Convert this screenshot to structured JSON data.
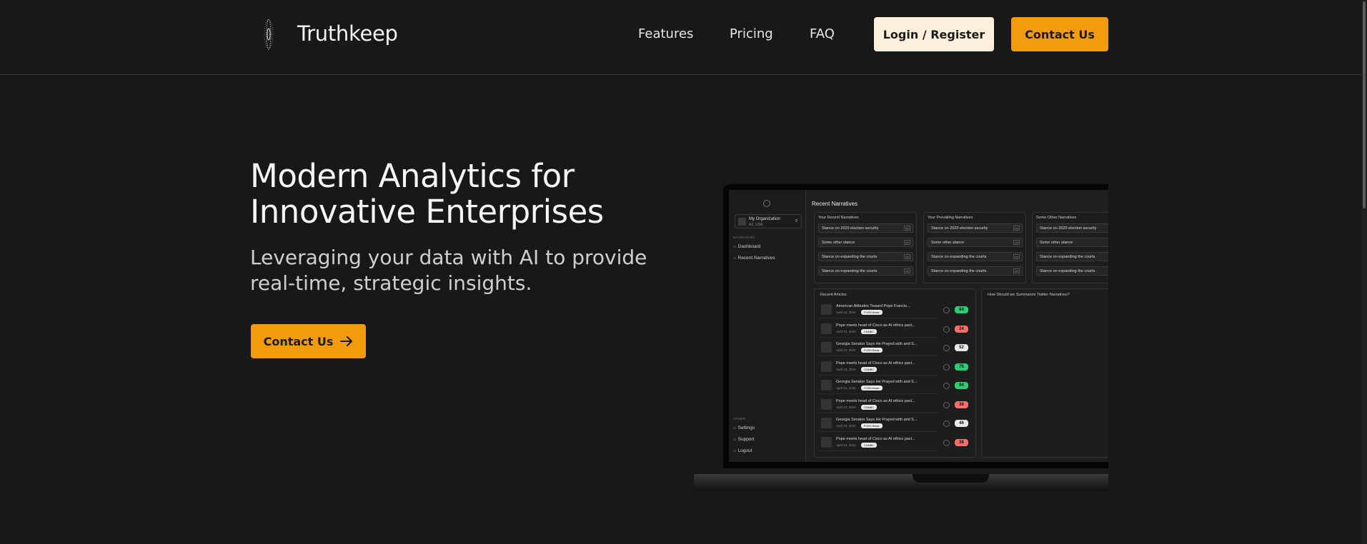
{
  "header": {
    "brand": "Truthkeep",
    "nav": [
      "Features",
      "Pricing",
      "FAQ"
    ],
    "login_label": "Login / Register",
    "contact_label": "Contact Us"
  },
  "hero": {
    "title_line1": "Modern Analytics for",
    "title_line2": "Innovative Enterprises",
    "subtitle_line1": "Leveraging your data with AI to provide",
    "subtitle_line2": "real-time, strategic insights.",
    "cta_label": "Contact Us",
    "cta_icon": "arrow-right-icon"
  },
  "colors": {
    "background": "#181818",
    "accent": "#f39c0b",
    "login_bg": "#fdf0dc"
  },
  "dashboard": {
    "org_name": "My Organization",
    "org_location": "AZ, USA",
    "nav_section": "NAVIGATION",
    "nav_items": [
      "Dashboard",
      "Recent Narratives"
    ],
    "other_section": "OTHER",
    "other_items": [
      "Settings",
      "Support",
      "Logout"
    ],
    "main_title": "Recent Narratives",
    "narrative_cards": [
      {
        "title": "Your Recent Narratives",
        "items": [
          "Stance on 2020 election security",
          "Some other stance",
          "Stance on expanding the courts",
          "Stance on expanding the courts"
        ]
      },
      {
        "title": "Your Prevailing Narratives",
        "items": [
          "Stance on 2020 election security",
          "Some other stance",
          "Stance on expanding the courts",
          "Stance on expanding the courts"
        ]
      },
      {
        "title": "Some Other Narratives",
        "items": [
          "Stance on 2020 election security",
          "Some other stance",
          "Stance on expanding the courts",
          "Stance on expanding the courts"
        ]
      }
    ],
    "articles_title": "Recent Articles",
    "summary_title": "How Should we Summarize Twitter Narratives?",
    "articles": [
      {
        "title": "American Attitudes Toward Pope Francis...",
        "date": "April 24, 2024",
        "tag": "FOX9 News",
        "score": "84",
        "score_color": "#2ecc71"
      },
      {
        "title": "Pope meets head of Cisco as AI ethics pact...",
        "date": "April 24, 2024",
        "tag": "CNNBC",
        "score": "24",
        "score_color": "#f1706a"
      },
      {
        "title": "Georgia Senator Says He Prayed with and S...",
        "date": "April 24, 2024",
        "tag": "FOX9 News",
        "score": "52",
        "score_color": "#e9e9e9"
      },
      {
        "title": "Pope meets head of Cisco as AI ethics pact...",
        "date": "April 24, 2024",
        "tag": "CNNBC",
        "score": "75",
        "score_color": "#2ecc71"
      },
      {
        "title": "Georgia Senator Says He Prayed with and S...",
        "date": "April 24, 2024",
        "tag": "FOX9 News",
        "score": "94",
        "score_color": "#2ecc71"
      },
      {
        "title": "Pope meets head of Cisco as AI ethics pact...",
        "date": "April 24, 2024",
        "tag": "CNNBC",
        "score": "36",
        "score_color": "#f1706a"
      },
      {
        "title": "Georgia Senator Says He Prayed with and S...",
        "date": "April 24, 2024",
        "tag": "FOX9 News",
        "score": "46",
        "score_color": "#e9e9e9"
      },
      {
        "title": "Pope meets head of Cisco as AI ethics pact...",
        "date": "April 24, 2024",
        "tag": "CNNBC",
        "score": "38",
        "score_color": "#f1706a"
      }
    ]
  }
}
